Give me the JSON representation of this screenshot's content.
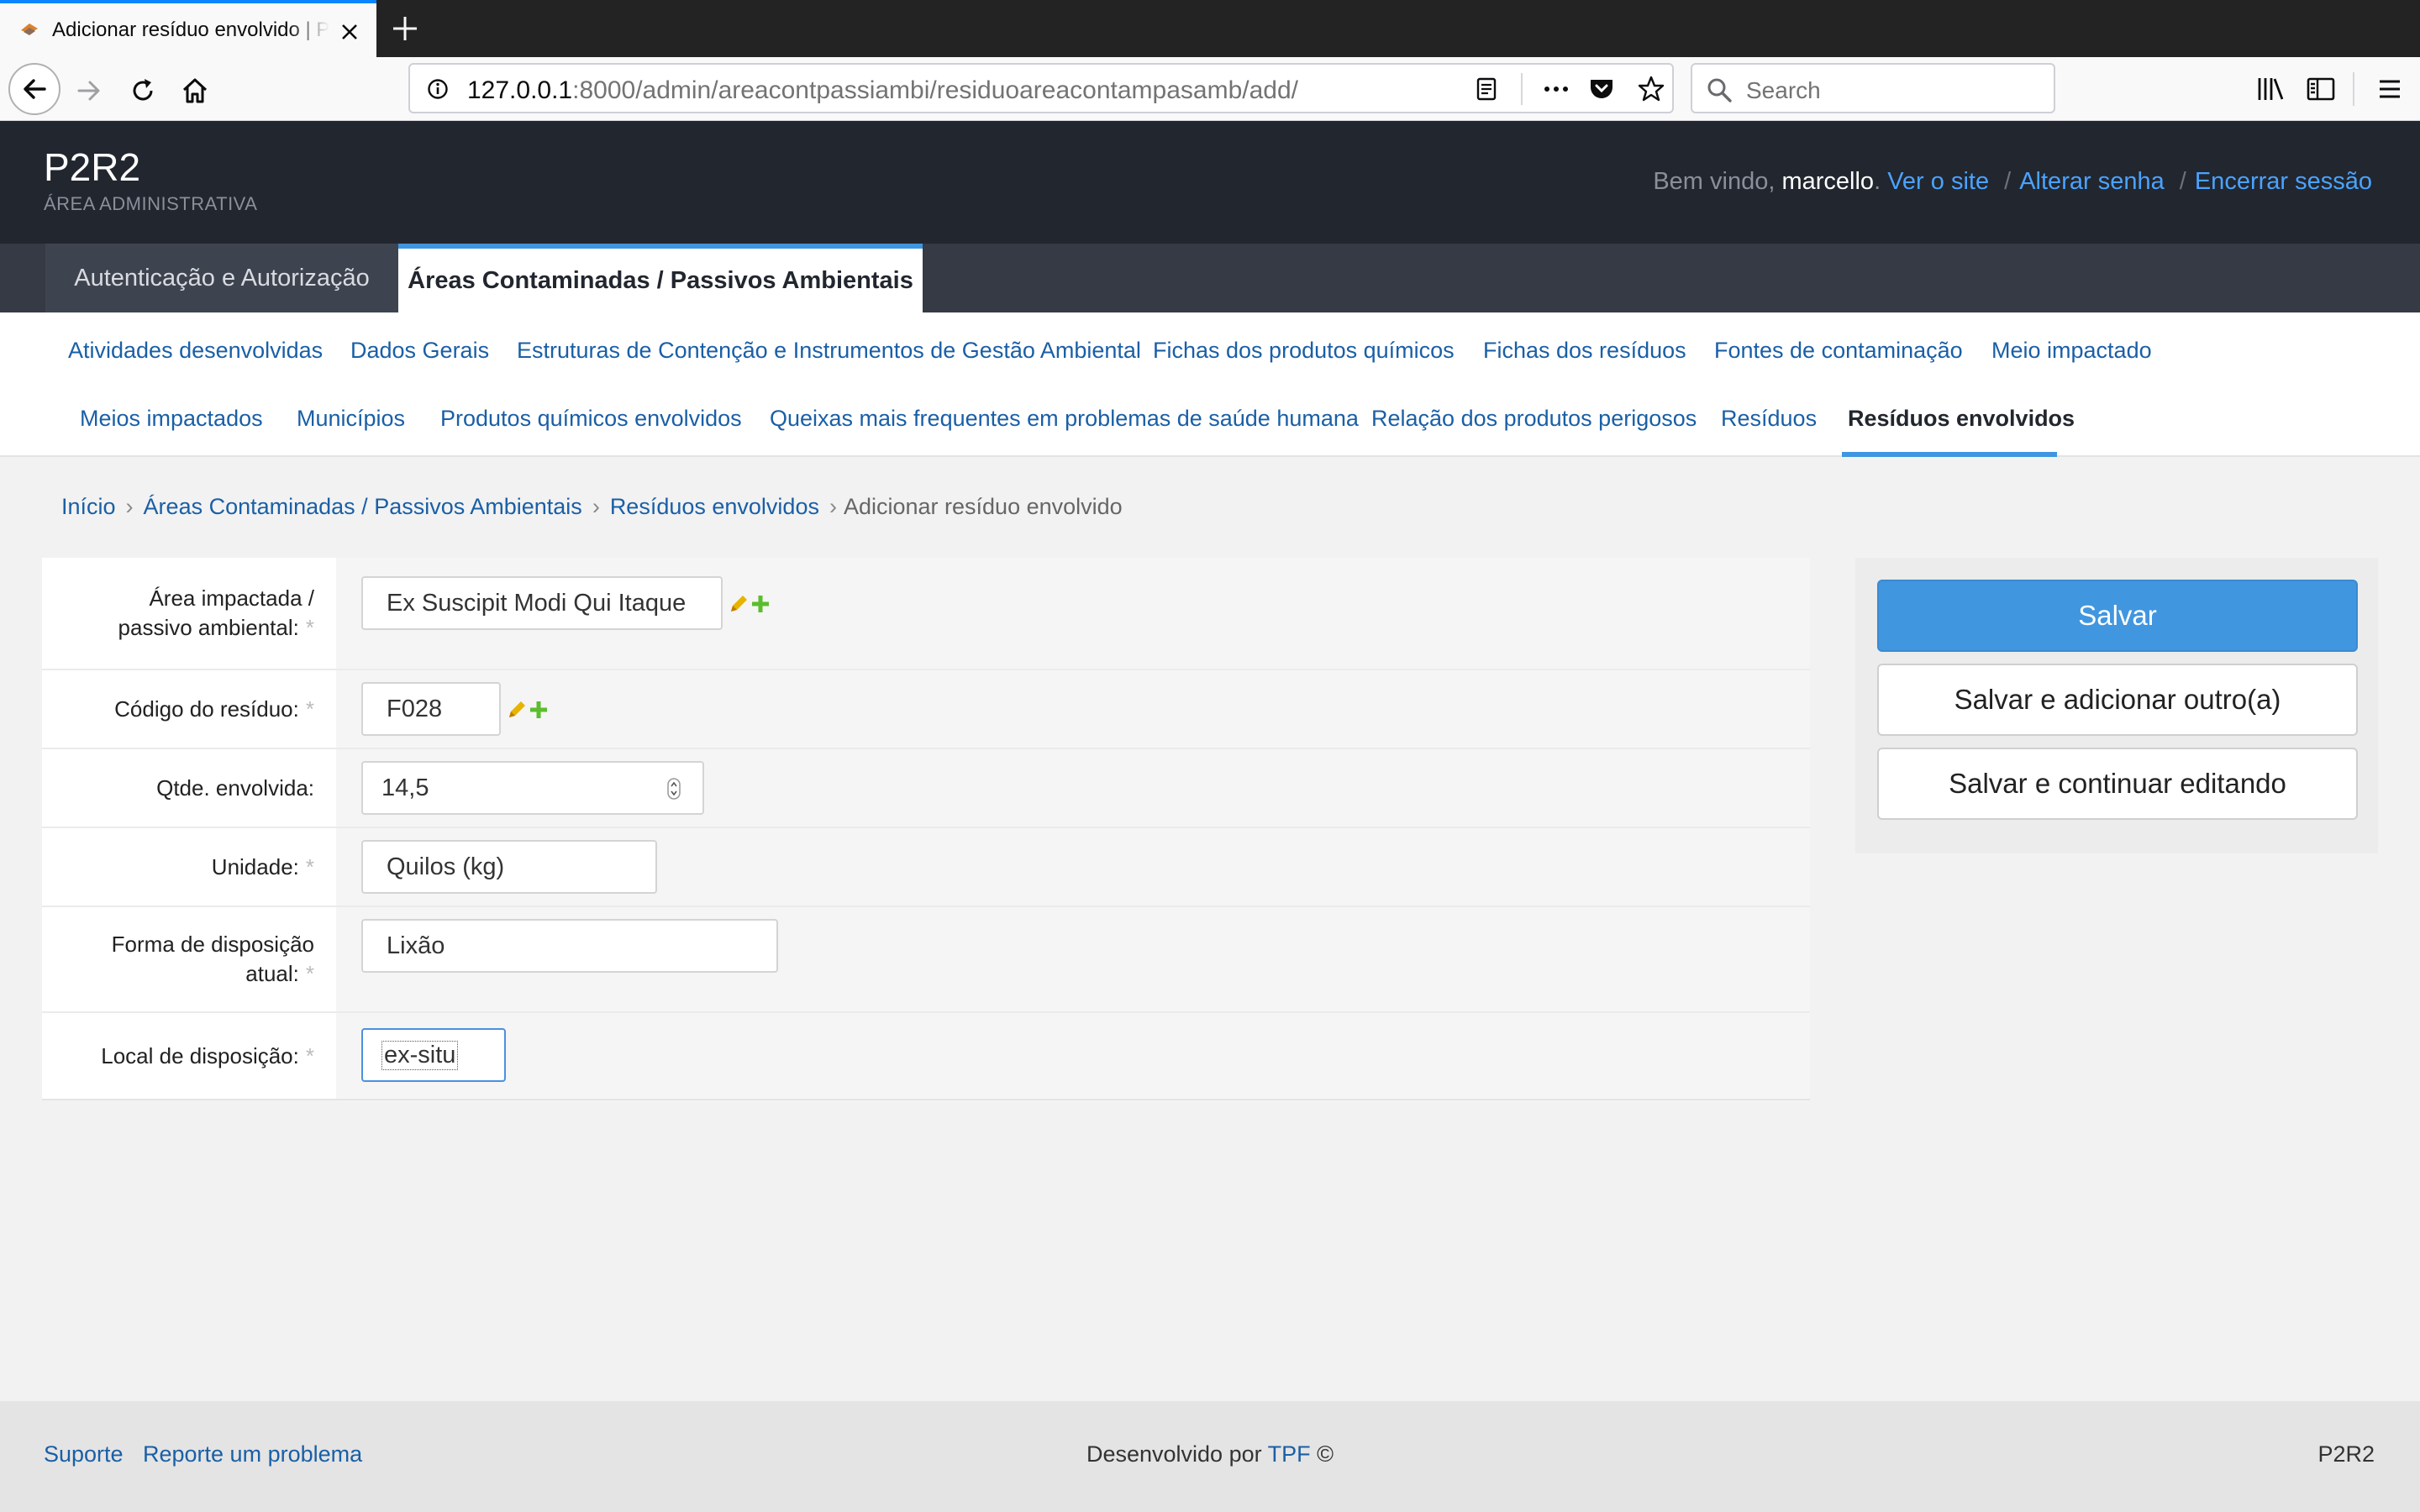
{
  "browser": {
    "tab_title": "Adicionar resíduo envolvido | P2R2",
    "url_host": "127.0.0.1",
    "url_rest": ":8000/admin/areacontpassiambi/residuoareacontampasamb/add/",
    "search_placeholder": "Search"
  },
  "header": {
    "site_name": "P2R2",
    "site_subtitle": "ÁREA ADMINISTRATIVA",
    "welcome": "Bem vindo,",
    "username": "marcello",
    "view_site": "Ver o site",
    "change_password": "Alterar senha",
    "logout": "Encerrar sessão"
  },
  "apps": [
    {
      "label": "Autenticação e Autorização"
    },
    {
      "label": "Áreas Contaminadas / Passivos Ambientais"
    }
  ],
  "models": [
    {
      "label": "Atividades desenvolvidas"
    },
    {
      "label": "Dados Gerais"
    },
    {
      "label": "Estruturas de Contenção e Instrumentos de Gestão Ambiental"
    },
    {
      "label": "Fichas dos produtos químicos"
    },
    {
      "label": "Fichas dos resíduos"
    },
    {
      "label": "Fontes de contaminação"
    },
    {
      "label": "Meio impactado"
    },
    {
      "label": "Meios impactados"
    },
    {
      "label": "Municípios"
    },
    {
      "label": "Produtos químicos envolvidos"
    },
    {
      "label": "Queixas mais frequentes em problemas de saúde humana"
    },
    {
      "label": "Relação dos produtos perigosos"
    },
    {
      "label": "Resíduos"
    },
    {
      "label": "Resíduos envolvidos"
    }
  ],
  "breadcrumbs": {
    "home": "Início",
    "app": "Áreas Contaminadas / Passivos Ambientais",
    "model": "Resíduos envolvidos",
    "current": "Adicionar resíduo envolvido",
    "sep": "›"
  },
  "form": {
    "required_mark": "*",
    "fields": [
      {
        "label_line1": "Área impactada /",
        "label_line2": "passivo ambiental:",
        "value": "Ex Suscipit Modi Qui Itaque"
      },
      {
        "label": "Código do resíduo:",
        "value": "F028"
      },
      {
        "label": "Qtde. envolvida:",
        "value": "14,5"
      },
      {
        "label": "Unidade:",
        "value": "Quilos (kg)"
      },
      {
        "label_line1": "Forma de disposição",
        "label_line2": "atual:",
        "value": "Lixão"
      },
      {
        "label": "Local de disposição:",
        "value": "ex-situ"
      }
    ]
  },
  "buttons": {
    "save": "Salvar",
    "save_add_another": "Salvar e adicionar outro(a)",
    "save_continue": "Salvar e continuar editando"
  },
  "footer": {
    "support": "Suporte",
    "report": "Reporte um problema",
    "developed_by": "Desenvolvido por",
    "developer": "TPF",
    "copyright": "©",
    "right_label": "P2R2"
  },
  "colors": {
    "header_bg": "#22262e",
    "apps_bar_bg": "#353a44",
    "accent_blue": "#3f95e0",
    "link_blue": "#1a5fa6",
    "edit_icon": "#e8b400",
    "add_icon": "#5bbd2b"
  },
  "icons": [
    "back-arrow-icon",
    "forward-arrow-icon",
    "reload-icon",
    "home-icon",
    "info-icon",
    "reader-view-icon",
    "page-actions-icon",
    "pocket-icon",
    "bookmark-star-icon",
    "search-icon",
    "library-icon",
    "sidebar-icon",
    "menu-icon",
    "pencil-edit-icon",
    "plus-add-icon",
    "number-spinner-icon"
  ]
}
